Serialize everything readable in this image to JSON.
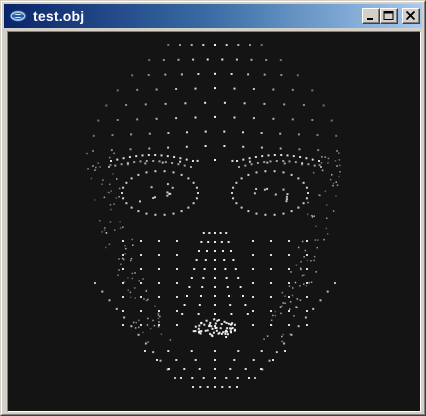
{
  "window": {
    "title": "test.obj",
    "app_icon": "app-icon",
    "buttons": {
      "minimize": "minimize-icon",
      "maximize": "maximize-icon",
      "close": "close-icon"
    }
  },
  "viewport": {
    "background_color": "#141414",
    "point_color": "#ffffff",
    "content": "3d-head-point-cloud"
  }
}
